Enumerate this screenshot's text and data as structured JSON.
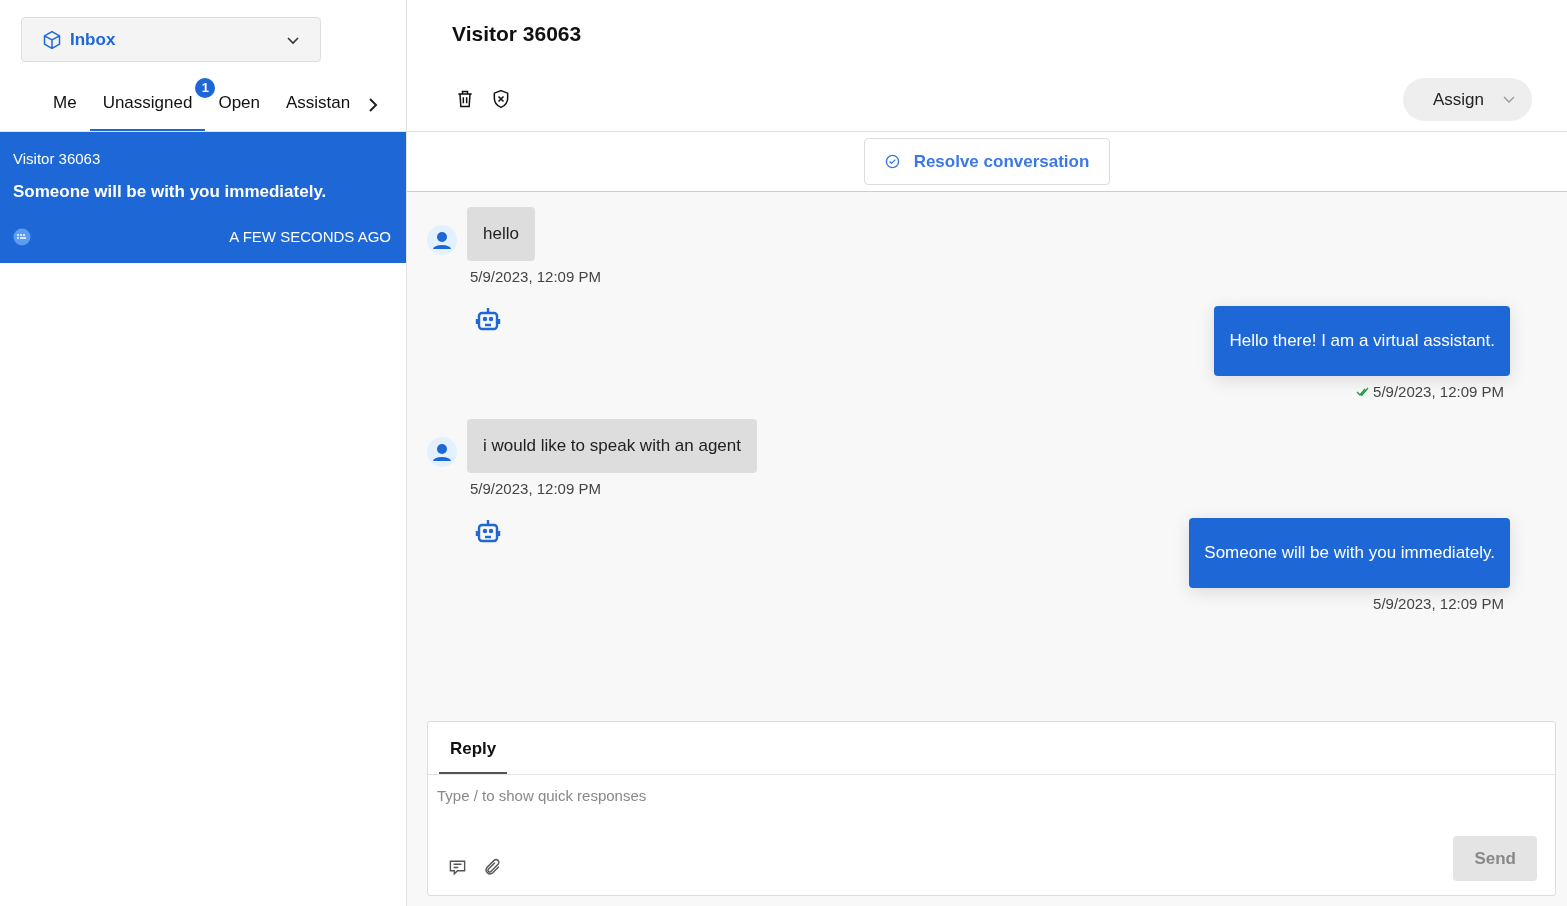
{
  "inbox_selector": {
    "label": "Inbox"
  },
  "tabs": [
    {
      "label": "Me",
      "selected": false
    },
    {
      "label": "Unassigned",
      "selected": true,
      "badge": "1"
    },
    {
      "label": "Open",
      "selected": false
    },
    {
      "label": "Assistan",
      "selected": false
    }
  ],
  "conversations": [
    {
      "name": "Visitor 36063",
      "preview": "Someone will be with you immediately.",
      "time": "A FEW SECONDS AGO",
      "selected": true
    }
  ],
  "header": {
    "title": "Visitor 36063",
    "assign_label": "Assign",
    "resolve_label": "Resolve conversation"
  },
  "messages": [
    {
      "kind": "visitor",
      "text": "hello",
      "time": "5/9/2023, 12:09 PM"
    },
    {
      "kind": "bot",
      "text": "Hello there! I am a virtual assistant.",
      "time": "5/9/2023, 12:09 PM",
      "read": true
    },
    {
      "kind": "visitor",
      "text": "i would like to speak with an agent",
      "time": "5/9/2023, 12:09 PM"
    },
    {
      "kind": "bot",
      "text": "Someone will be with you immediately.",
      "time": "5/9/2023, 12:09 PM",
      "read": false
    }
  ],
  "composer": {
    "tab": "Reply",
    "placeholder": "Type / to show quick responses",
    "send_label": "Send",
    "send_disabled": true
  }
}
